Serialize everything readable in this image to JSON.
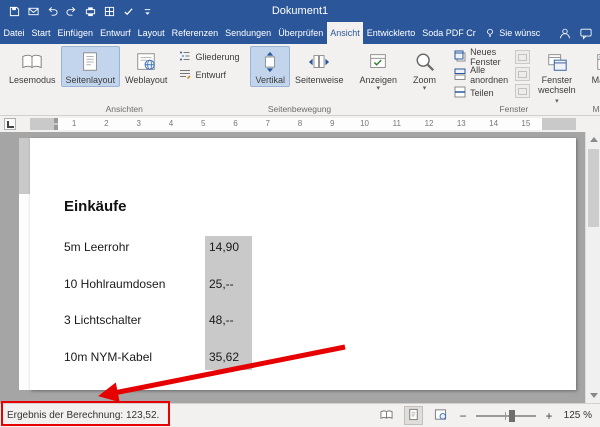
{
  "colors": {
    "titlebar_blue": "#2b579a",
    "selection_gray": "#c9c9c9",
    "active_button_bg": "#c3d5ec",
    "annotation_red": "#e60000"
  },
  "titlebar": {
    "title": "Dokument1"
  },
  "tabs": {
    "file": "Datei",
    "items": [
      {
        "label": "Start"
      },
      {
        "label": "Einfügen"
      },
      {
        "label": "Entwurf"
      },
      {
        "label": "Layout"
      },
      {
        "label": "Referenzen"
      },
      {
        "label": "Sendungen"
      },
      {
        "label": "Überprüfen"
      },
      {
        "label": "Ansicht"
      },
      {
        "label": "Entwicklerto"
      },
      {
        "label": "Soda PDF Cr"
      }
    ],
    "tellme": "Sie wünsc"
  },
  "ribbon": {
    "views_group": {
      "label": "Ansichten",
      "read_mode": "Lesemodus",
      "print_layout": "Seitenlayout",
      "web_layout": "Weblayout",
      "outline": "Gliederung",
      "draft": "Entwurf"
    },
    "page_movement_group": {
      "label": "Seitenbewegung",
      "vertical": "Vertikal",
      "side_to_side": "Seitenweise"
    },
    "show_button": "Anzeigen",
    "zoom_button": "Zoom",
    "window_group": {
      "label": "Fenster",
      "new_window": "Neues Fenster",
      "arrange_all": "Alle anordnen",
      "split": "Teilen",
      "switch_windows_line1": "Fenster",
      "switch_windows_line2": "wechseln"
    },
    "macros_group": {
      "label": "Makros",
      "macros": "Makros"
    }
  },
  "ruler": {
    "numbers": [
      "1",
      "2",
      "3",
      "4",
      "5",
      "6",
      "7",
      "8",
      "9",
      "10",
      "11",
      "12",
      "13",
      "14",
      "15"
    ]
  },
  "document": {
    "heading": "Einkäufe",
    "items": [
      {
        "name": "5m Leerrohr",
        "price": "14,90"
      },
      {
        "name": "10 Hohlraumdosen",
        "price": "25,--"
      },
      {
        "name": "3 Lichtschalter",
        "price": "48,--"
      },
      {
        "name": "10m NYM-Kabel",
        "price": "35,62"
      }
    ]
  },
  "statusbar": {
    "result": "Ergebnis der Berechnung: 123,52.",
    "zoom_level": "125 %"
  }
}
